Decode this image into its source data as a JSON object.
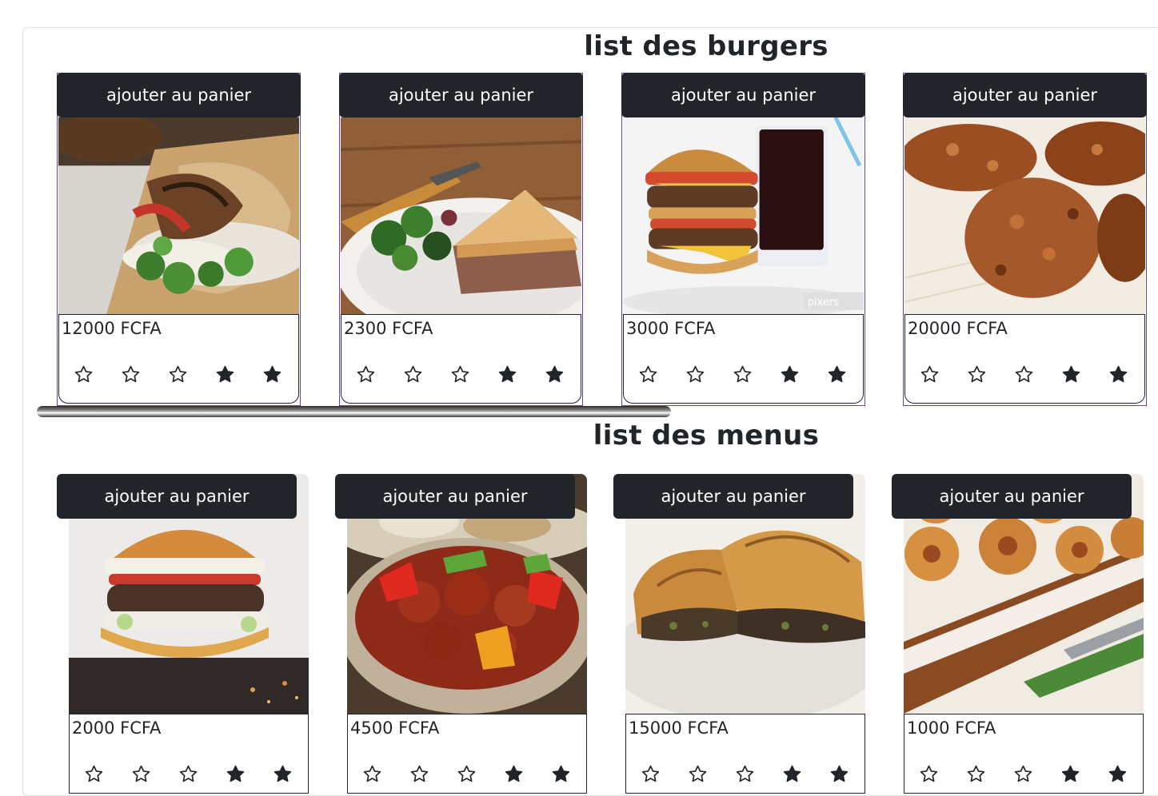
{
  "sections": [
    {
      "title": "list des burgers",
      "items": [
        {
          "button_label": "ajouter au panier",
          "image": "chicken-wrap",
          "price": "12000 FCFA",
          "rating": 2,
          "max_rating": 5
        },
        {
          "button_label": "ajouter au panier",
          "image": "meat-pie-salad",
          "price": "2300 FCFA",
          "rating": 2,
          "max_rating": 5
        },
        {
          "button_label": "ajouter au panier",
          "image": "burger-and-soda",
          "price": "3000 FCFA",
          "rating": 2,
          "max_rating": 5
        },
        {
          "button_label": "ajouter au panier",
          "image": "fried-chicken",
          "price": "20000 FCFA",
          "rating": 2,
          "max_rating": 5
        }
      ]
    },
    {
      "title": "list des menus",
      "items": [
        {
          "button_label": "ajouter au panier",
          "image": "cheeseburger",
          "price": "2000 FCFA",
          "rating": 2,
          "max_rating": 5
        },
        {
          "button_label": "ajouter au panier",
          "image": "sweet-sour-pork",
          "price": "4500 FCFA",
          "rating": 2,
          "max_rating": 5
        },
        {
          "button_label": "ajouter au panier",
          "image": "borek-pastry",
          "price": "15000 FCFA",
          "rating": 2,
          "max_rating": 5
        },
        {
          "button_label": "ajouter au panier",
          "image": "pinwheel-rolls",
          "price": "1000 FCFA",
          "rating": 2,
          "max_rating": 5
        }
      ]
    }
  ],
  "image_watermark": "pixers",
  "colors": {
    "button_bg": "#212529",
    "button_text": "#ffffff",
    "card_outline": "#6a3fb3",
    "text": "#212529"
  },
  "icons": {
    "filled_star": "filled-star-icon",
    "empty_star": "empty-star-icon"
  }
}
